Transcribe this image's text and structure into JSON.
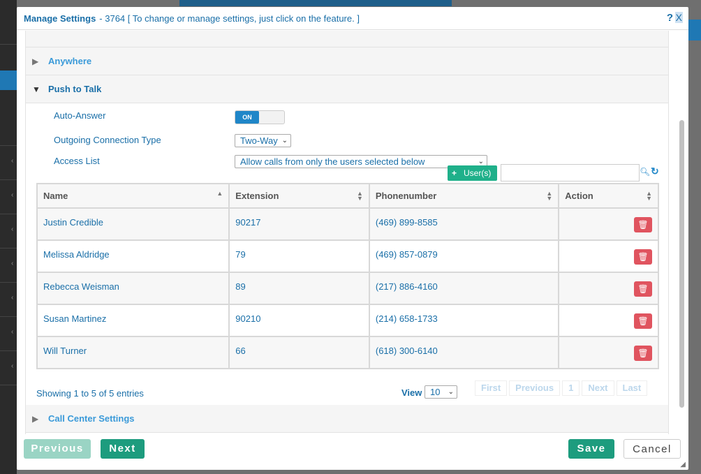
{
  "header": {
    "title": "Manage Settings",
    "subtitle": "- 3764 [ To change or manage settings, just click on the feature. ]",
    "help": "?",
    "close": "X"
  },
  "sections": {
    "anywhere": "Anywhere",
    "push_to_talk": "Push to Talk",
    "call_center": "Call Center Settings"
  },
  "push_to_talk": {
    "auto_answer_label": "Auto-Answer",
    "auto_answer_value": "ON",
    "connection_label": "Outgoing Connection Type",
    "connection_value": "Two-Way",
    "access_label": "Access List",
    "access_value": "Allow calls from only the users selected below",
    "add_user_label": "User(s)",
    "search_placeholder": ""
  },
  "table": {
    "columns": [
      "Name",
      "Extension",
      "Phonenumber",
      "Action"
    ],
    "rows": [
      {
        "name": "Justin Credible",
        "extension": "90217",
        "phone": "(469) 899-8585"
      },
      {
        "name": "Melissa Aldridge",
        "extension": "79",
        "phone": "(469) 857-0879"
      },
      {
        "name": "Rebecca Weisman",
        "extension": "89",
        "phone": "(217) 886-4160"
      },
      {
        "name": "Susan Martinez",
        "extension": "90210",
        "phone": "(214) 658-1733"
      },
      {
        "name": "Will Turner",
        "extension": "66",
        "phone": "(618) 300-6140"
      }
    ]
  },
  "pagination": {
    "showing": "Showing 1 to 5 of 5 entries",
    "view_label": "View",
    "view_value": "10",
    "first": "First",
    "previous": "Previous",
    "page": "1",
    "next": "Next",
    "last": "Last"
  },
  "footer": {
    "previous": "Previous",
    "next": "Next",
    "save": "Save",
    "cancel": "Cancel"
  },
  "colors": {
    "primary_text": "#1a6fa8",
    "accent_green": "#1d9c7e",
    "toggle_blue": "#1f86c8",
    "delete_red": "#e0545f"
  }
}
